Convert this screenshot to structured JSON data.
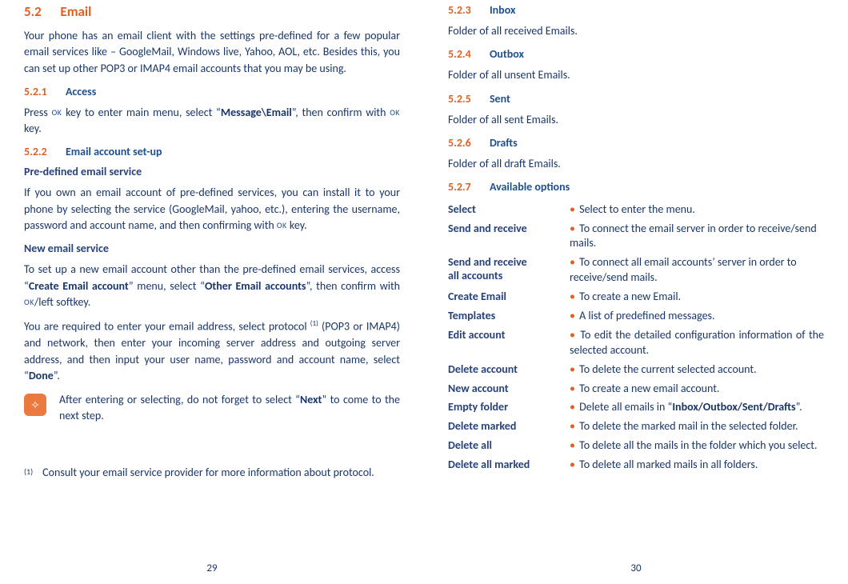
{
  "left": {
    "sec_num": "5.2",
    "sec_title": "Email",
    "intro": "Your phone has an email client with the settings pre-defined for a few popular email services like – GoogleMail, Windows live, Yahoo, AOL, etc. Besides this, you can set up other POP3 or IMAP4 email accounts that you may be using.",
    "s1_num": "5.2.1",
    "s1_title": "Access",
    "access_part1": "Press ",
    "access_part2": " key to enter main menu, select “",
    "access_strong": "Message\\Email",
    "access_part3": "”, then confirm with ",
    "access_part4": " key.",
    "s2_num": "5.2.2",
    "s2_title": "Email account set-up",
    "predef_label": "Pre-defined email service",
    "predef_text1": "If you own an email account of pre-defined services, you can install it to your phone by selecting the service (GoogleMail, yahoo, etc.), entering the username, password and account name, and then confirming with ",
    "predef_text2": " key.",
    "new_label": "New email service",
    "new_p1a": "To set up a new email account other than the pre-defined email services, access “",
    "new_p1b": "Create Email account",
    "new_p1c": "” menu, select “",
    "new_p1d": "Other Email accounts",
    "new_p1e": "”, then confirm with ",
    "new_p1f": "/left softkey.",
    "new_p2a": "You are required to enter your email address, select protocol ",
    "new_p2b": " (POP3 or IMAP4) and network, then enter your incoming server address and outgoing server address, and then input your user name, password and account name, select “",
    "new_p2c": "Done",
    "new_p2d": "”.",
    "note1": "After entering or selecting, do not forget to select “",
    "note2": "Next",
    "note3": "” to come to the next step.",
    "foot_marker": "(1)",
    "foot_text": "Consult your email service provider for more information about protocol.",
    "page_num": "29"
  },
  "right": {
    "s3_num": "5.2.3",
    "s3_title": "Inbox",
    "s3_text": "Folder of all received Emails.",
    "s4_num": "5.2.4",
    "s4_title": "Outbox",
    "s4_text": "Folder of all unsent Emails.",
    "s5_num": "5.2.5",
    "s5_title": "Sent",
    "s5_text": "Folder of all sent Emails.",
    "s6_num": "5.2.6",
    "s6_title": "Drafts",
    "s6_text": "Folder of all draft Emails.",
    "s7_num": "5.2.7",
    "s7_title": "Available options",
    "options": {
      "select": {
        "label": "Select",
        "desc": "Select to enter the menu."
      },
      "sendreceive": {
        "label": "Send and receive",
        "desc": "To connect the email server in order to receive/send mails."
      },
      "sendreceive_all": {
        "label1": "Send and receive",
        "label2": "all accounts",
        "desc": "To connect all email accounts’ server in order to receive/send mails."
      },
      "create": {
        "label": "Create Email",
        "desc": "To create a new Email."
      },
      "templates": {
        "label": "Templates",
        "desc": "A list of predefined messages."
      },
      "edit": {
        "label": "Edit account",
        "desc": "To edit the detailed configuration information of the selected account."
      },
      "delacct": {
        "label": "Delete account",
        "desc": "To delete the current selected account."
      },
      "newacct": {
        "label": "New account",
        "desc": "To create a new email account."
      },
      "empty": {
        "label": "Empty folder",
        "desc1": "Delete all emails in “",
        "desc_bold": "Inbox/Outbox/Sent/Drafts",
        "desc2": "”."
      },
      "delmarked": {
        "label": "Delete marked",
        "desc": "To delete the marked mail in the selected folder."
      },
      "delall": {
        "label": "Delete all",
        "desc": "To delete all the mails in the folder which you select."
      },
      "delallmarked": {
        "label": "Delete all marked",
        "desc": "To delete all marked mails in all folders."
      }
    },
    "page_num": "30"
  },
  "ok_text": "OK"
}
